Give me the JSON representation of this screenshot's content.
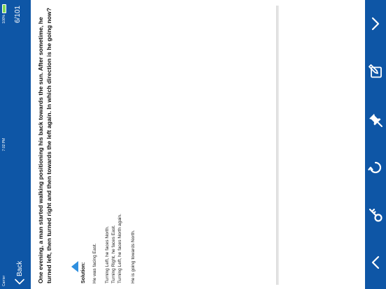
{
  "status_bar": {
    "carrier": "Carrier",
    "time": "7:02 PM",
    "battery_percent": "100%",
    "battery_level": 1.0
  },
  "nav": {
    "back_label": "Back",
    "page_counter": "6/101"
  },
  "question": {
    "text": "One evening, a man started walking positioning his back towards the sun. After sometime, he turned left, then turned right and then towards the left again. In which direction is he going now?"
  },
  "solution": {
    "title": "Solution:",
    "lines": [
      "He was facing East.",
      "Turning Left, he faces North.",
      "Turning Right, he faces East.",
      "Turning Left, he faces North again.",
      "He is going towards North."
    ]
  },
  "toolbar": {
    "icons": [
      "chevron-up-icon",
      "key-icon",
      "refresh-icon",
      "pin-icon",
      "edit-icon",
      "chevron-down-icon"
    ]
  },
  "colors": {
    "bar_blue": "#0e56a6",
    "accent_blue": "#2f8fdf",
    "battery_green": "#7ed957"
  }
}
